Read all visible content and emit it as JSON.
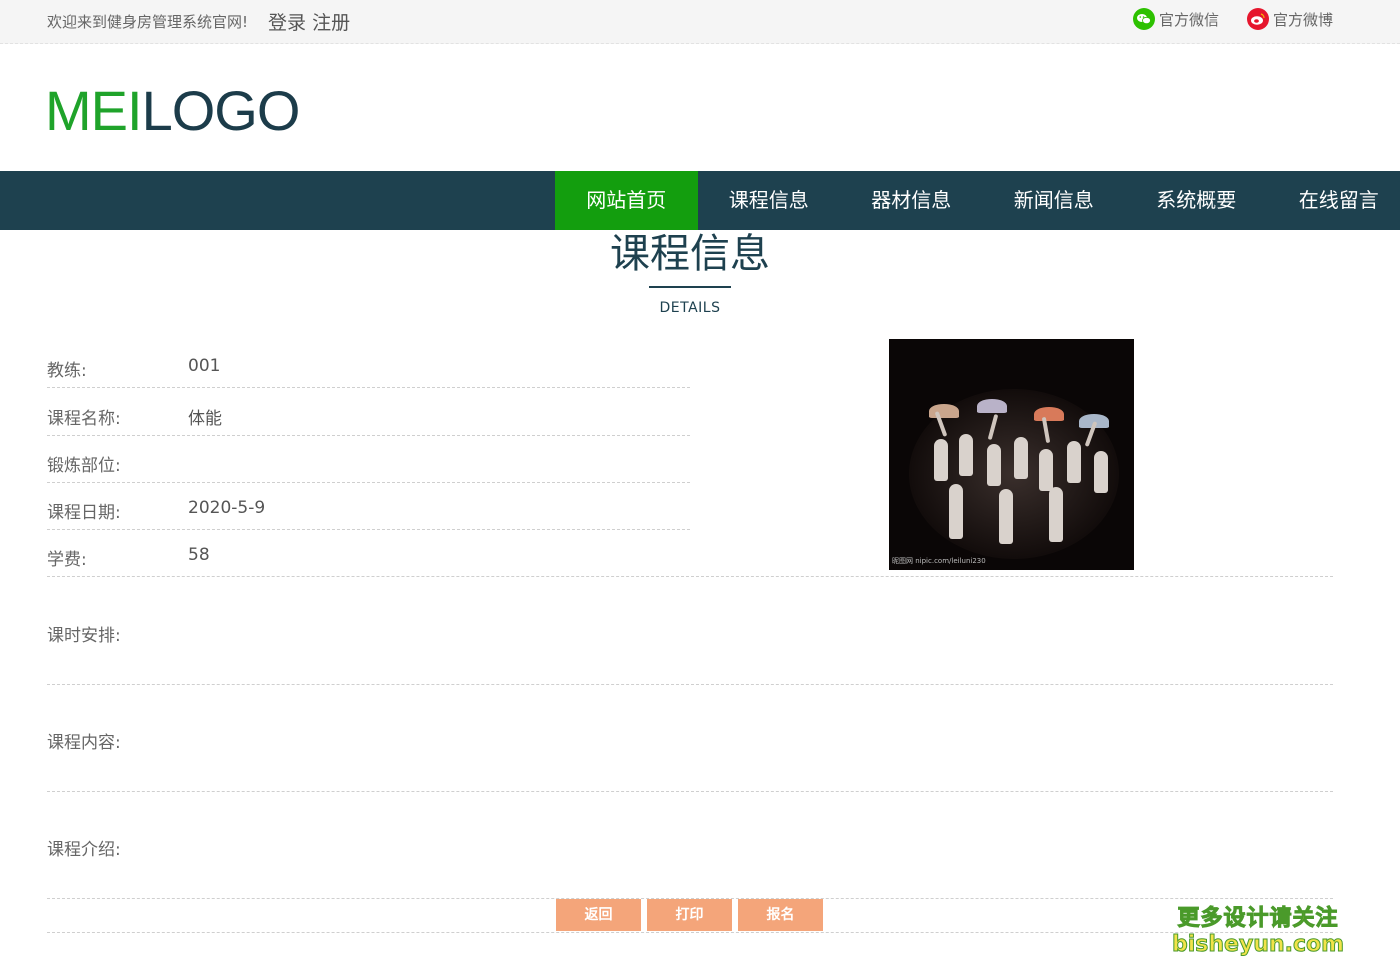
{
  "topbar": {
    "welcome": "欢迎来到健身房管理系统官网!",
    "login": "登录",
    "register": "注册",
    "wechat_label": "官方微信",
    "weibo_label": "官方微博",
    "wechat_icon": "wechat-icon",
    "weibo_icon": "weibo-icon"
  },
  "logo": {
    "part1": "MEI",
    "part2": "LOGO"
  },
  "nav": {
    "items": [
      "网站首页",
      "课程信息",
      "器材信息",
      "新闻信息",
      "系统概要",
      "在线留言"
    ],
    "active_index": 0
  },
  "heading": {
    "title": "课程信息",
    "subtitle": "DETAILS"
  },
  "details": {
    "coach_label": "教练:",
    "coach_value": "001",
    "name_label": "课程名称:",
    "name_value": "体能",
    "part_label": "锻炼部位:",
    "part_value": "",
    "date_label": "课程日期:",
    "date_value": "2020-5-9",
    "fee_label": "学费:",
    "fee_value": "58",
    "schedule_label": "课时安排:",
    "content_label": "课程内容:",
    "intro_label": "课程介绍:"
  },
  "photo": {
    "watermark": "昵图网 nipic.com/leiluni230"
  },
  "buttons": {
    "back": "返回",
    "print": "打印",
    "enroll": "报名"
  },
  "watermark": {
    "line1": "更多设计请关注",
    "line2": "bisheyun.com"
  },
  "colors": {
    "nav_bg": "#1e414f",
    "nav_active": "#139e0e",
    "button": "#f4a57a",
    "logo_green": "#1fa32a",
    "logo_dark": "#1c3c4a"
  }
}
